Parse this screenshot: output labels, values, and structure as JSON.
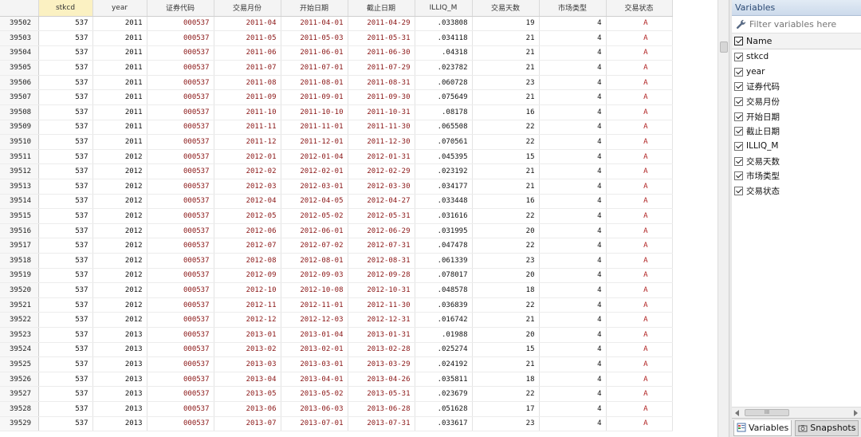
{
  "grid": {
    "columns": [
      "stkcd",
      "year",
      "证券代码",
      "交易月份",
      "开始日期",
      "截止日期",
      "ILLIQ_M",
      "交易天数",
      "市场类型",
      "交易状态"
    ],
    "rows": [
      {
        "rn": "39502",
        "stkcd": "537",
        "year": "2011",
        "code": "000537",
        "month": "2011-04",
        "start": "2011-04-01",
        "end": "2011-04-29",
        "illiq": ".033808",
        "days": "19",
        "mkt": "4",
        "status": "A"
      },
      {
        "rn": "39503",
        "stkcd": "537",
        "year": "2011",
        "code": "000537",
        "month": "2011-05",
        "start": "2011-05-03",
        "end": "2011-05-31",
        "illiq": ".034118",
        "days": "21",
        "mkt": "4",
        "status": "A"
      },
      {
        "rn": "39504",
        "stkcd": "537",
        "year": "2011",
        "code": "000537",
        "month": "2011-06",
        "start": "2011-06-01",
        "end": "2011-06-30",
        "illiq": ".04318",
        "days": "21",
        "mkt": "4",
        "status": "A"
      },
      {
        "rn": "39505",
        "stkcd": "537",
        "year": "2011",
        "code": "000537",
        "month": "2011-07",
        "start": "2011-07-01",
        "end": "2011-07-29",
        "illiq": ".023782",
        "days": "21",
        "mkt": "4",
        "status": "A"
      },
      {
        "rn": "39506",
        "stkcd": "537",
        "year": "2011",
        "code": "000537",
        "month": "2011-08",
        "start": "2011-08-01",
        "end": "2011-08-31",
        "illiq": ".060728",
        "days": "23",
        "mkt": "4",
        "status": "A"
      },
      {
        "rn": "39507",
        "stkcd": "537",
        "year": "2011",
        "code": "000537",
        "month": "2011-09",
        "start": "2011-09-01",
        "end": "2011-09-30",
        "illiq": ".075649",
        "days": "21",
        "mkt": "4",
        "status": "A"
      },
      {
        "rn": "39508",
        "stkcd": "537",
        "year": "2011",
        "code": "000537",
        "month": "2011-10",
        "start": "2011-10-10",
        "end": "2011-10-31",
        "illiq": ".08178",
        "days": "16",
        "mkt": "4",
        "status": "A"
      },
      {
        "rn": "39509",
        "stkcd": "537",
        "year": "2011",
        "code": "000537",
        "month": "2011-11",
        "start": "2011-11-01",
        "end": "2011-11-30",
        "illiq": ".065508",
        "days": "22",
        "mkt": "4",
        "status": "A"
      },
      {
        "rn": "39510",
        "stkcd": "537",
        "year": "2011",
        "code": "000537",
        "month": "2011-12",
        "start": "2011-12-01",
        "end": "2011-12-30",
        "illiq": ".070561",
        "days": "22",
        "mkt": "4",
        "status": "A"
      },
      {
        "rn": "39511",
        "stkcd": "537",
        "year": "2012",
        "code": "000537",
        "month": "2012-01",
        "start": "2012-01-04",
        "end": "2012-01-31",
        "illiq": ".045395",
        "days": "15",
        "mkt": "4",
        "status": "A"
      },
      {
        "rn": "39512",
        "stkcd": "537",
        "year": "2012",
        "code": "000537",
        "month": "2012-02",
        "start": "2012-02-01",
        "end": "2012-02-29",
        "illiq": ".023192",
        "days": "21",
        "mkt": "4",
        "status": "A"
      },
      {
        "rn": "39513",
        "stkcd": "537",
        "year": "2012",
        "code": "000537",
        "month": "2012-03",
        "start": "2012-03-01",
        "end": "2012-03-30",
        "illiq": ".034177",
        "days": "21",
        "mkt": "4",
        "status": "A"
      },
      {
        "rn": "39514",
        "stkcd": "537",
        "year": "2012",
        "code": "000537",
        "month": "2012-04",
        "start": "2012-04-05",
        "end": "2012-04-27",
        "illiq": ".033448",
        "days": "16",
        "mkt": "4",
        "status": "A"
      },
      {
        "rn": "39515",
        "stkcd": "537",
        "year": "2012",
        "code": "000537",
        "month": "2012-05",
        "start": "2012-05-02",
        "end": "2012-05-31",
        "illiq": ".031616",
        "days": "22",
        "mkt": "4",
        "status": "A"
      },
      {
        "rn": "39516",
        "stkcd": "537",
        "year": "2012",
        "code": "000537",
        "month": "2012-06",
        "start": "2012-06-01",
        "end": "2012-06-29",
        "illiq": ".031995",
        "days": "20",
        "mkt": "4",
        "status": "A"
      },
      {
        "rn": "39517",
        "stkcd": "537",
        "year": "2012",
        "code": "000537",
        "month": "2012-07",
        "start": "2012-07-02",
        "end": "2012-07-31",
        "illiq": ".047478",
        "days": "22",
        "mkt": "4",
        "status": "A"
      },
      {
        "rn": "39518",
        "stkcd": "537",
        "year": "2012",
        "code": "000537",
        "month": "2012-08",
        "start": "2012-08-01",
        "end": "2012-08-31",
        "illiq": ".061339",
        "days": "23",
        "mkt": "4",
        "status": "A"
      },
      {
        "rn": "39519",
        "stkcd": "537",
        "year": "2012",
        "code": "000537",
        "month": "2012-09",
        "start": "2012-09-03",
        "end": "2012-09-28",
        "illiq": ".078017",
        "days": "20",
        "mkt": "4",
        "status": "A"
      },
      {
        "rn": "39520",
        "stkcd": "537",
        "year": "2012",
        "code": "000537",
        "month": "2012-10",
        "start": "2012-10-08",
        "end": "2012-10-31",
        "illiq": ".048578",
        "days": "18",
        "mkt": "4",
        "status": "A"
      },
      {
        "rn": "39521",
        "stkcd": "537",
        "year": "2012",
        "code": "000537",
        "month": "2012-11",
        "start": "2012-11-01",
        "end": "2012-11-30",
        "illiq": ".036839",
        "days": "22",
        "mkt": "4",
        "status": "A"
      },
      {
        "rn": "39522",
        "stkcd": "537",
        "year": "2012",
        "code": "000537",
        "month": "2012-12",
        "start": "2012-12-03",
        "end": "2012-12-31",
        "illiq": ".016742",
        "days": "21",
        "mkt": "4",
        "status": "A"
      },
      {
        "rn": "39523",
        "stkcd": "537",
        "year": "2013",
        "code": "000537",
        "month": "2013-01",
        "start": "2013-01-04",
        "end": "2013-01-31",
        "illiq": ".01988",
        "days": "20",
        "mkt": "4",
        "status": "A"
      },
      {
        "rn": "39524",
        "stkcd": "537",
        "year": "2013",
        "code": "000537",
        "month": "2013-02",
        "start": "2013-02-01",
        "end": "2013-02-28",
        "illiq": ".025274",
        "days": "15",
        "mkt": "4",
        "status": "A"
      },
      {
        "rn": "39525",
        "stkcd": "537",
        "year": "2013",
        "code": "000537",
        "month": "2013-03",
        "start": "2013-03-01",
        "end": "2013-03-29",
        "illiq": ".024192",
        "days": "21",
        "mkt": "4",
        "status": "A"
      },
      {
        "rn": "39526",
        "stkcd": "537",
        "year": "2013",
        "code": "000537",
        "month": "2013-04",
        "start": "2013-04-01",
        "end": "2013-04-26",
        "illiq": ".035811",
        "days": "18",
        "mkt": "4",
        "status": "A"
      },
      {
        "rn": "39527",
        "stkcd": "537",
        "year": "2013",
        "code": "000537",
        "month": "2013-05",
        "start": "2013-05-02",
        "end": "2013-05-31",
        "illiq": ".023679",
        "days": "22",
        "mkt": "4",
        "status": "A"
      },
      {
        "rn": "39528",
        "stkcd": "537",
        "year": "2013",
        "code": "000537",
        "month": "2013-06",
        "start": "2013-06-03",
        "end": "2013-06-28",
        "illiq": ".051628",
        "days": "17",
        "mkt": "4",
        "status": "A"
      },
      {
        "rn": "39529",
        "stkcd": "537",
        "year": "2013",
        "code": "000537",
        "month": "2013-07",
        "start": "2013-07-01",
        "end": "2013-07-31",
        "illiq": ".033617",
        "days": "23",
        "mkt": "4",
        "status": "A"
      }
    ]
  },
  "variables": {
    "title": "Variables",
    "filter_placeholder": "Filter variables here",
    "header": "Name",
    "items": [
      "stkcd",
      "year",
      "证券代码",
      "交易月份",
      "开始日期",
      "截止日期",
      "ILLIQ_M",
      "交易天数",
      "市场类型",
      "交易状态"
    ],
    "hscroll_grip": "III",
    "tabs": [
      "Variables",
      "Snapshots"
    ]
  },
  "colors": {
    "string_text": "#8a1515",
    "status_text": "#b02222",
    "header_highlight": "#fbf1c2",
    "panel_title": "#2b4a74"
  },
  "icons": [
    "wrench-icon",
    "checkbox-icon",
    "variables-tab-icon",
    "snapshots-tab-icon"
  ]
}
